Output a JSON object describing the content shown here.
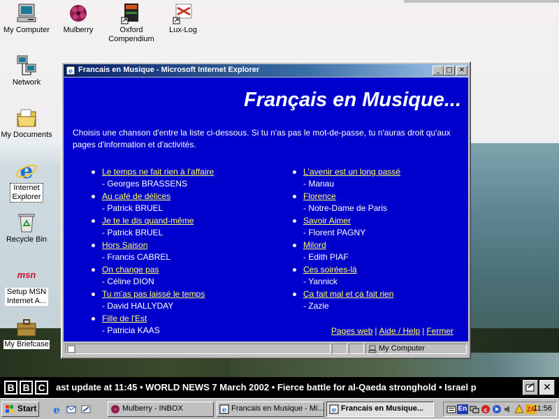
{
  "desktop": {
    "icons": [
      {
        "label": "My Computer",
        "icon": "my-computer-icon"
      },
      {
        "label": "Mulberry",
        "icon": "mulberry-icon"
      },
      {
        "label": "Oxford Compendium",
        "icon": "oxford-compendium-icon"
      },
      {
        "label": "Lux-Log",
        "icon": "lux-log-icon"
      },
      {
        "label": "Network",
        "icon": "network-icon"
      },
      {
        "label": "My Documents",
        "icon": "my-documents-icon"
      },
      {
        "label": "Internet Explorer",
        "icon": "internet-explorer-icon"
      },
      {
        "label": "Recycle Bin",
        "icon": "recycle-bin-icon"
      },
      {
        "label": "Setup MSN Internet A...",
        "icon": "msn-icon"
      },
      {
        "label": "My Briefcase",
        "icon": "briefcase-icon"
      }
    ]
  },
  "window": {
    "title": "Francais en Musique - Microsoft Internet Explorer",
    "heading": "Français en Musique...",
    "intro": "Choisis une chanson d'entre la liste ci-dessous. Si tu n'as pas le mot-de-passe, tu n'auras droit qu'aux pages d'information et d'activités.",
    "songs_left": [
      {
        "title": "Le temps ne fait rien à l'affaire",
        "artist": "- Georges BRASSENS"
      },
      {
        "title": "Au café de délices",
        "artist": "- Patrick BRUEL"
      },
      {
        "title": "Je te le dis quand-même",
        "artist": "- Patrick BRUEL"
      },
      {
        "title": "Hors Saison",
        "artist": "- Francis CABREL"
      },
      {
        "title": "On change pas",
        "artist": "- Céline DION"
      },
      {
        "title": "Tu m'as pas laissé le temps",
        "artist": "- David HALLYDAY"
      },
      {
        "title": "Fille de l'Est",
        "artist": "- Patricia KAAS"
      }
    ],
    "songs_right": [
      {
        "title": "L'avenir est un long passé",
        "artist": "- Manau"
      },
      {
        "title": "Florence",
        "artist": "- Notre-Dame de Paris"
      },
      {
        "title": "Savoir Aimer",
        "artist": "- Florent PAGNY"
      },
      {
        "title": "Milord",
        "artist": "- Edith PIAF"
      },
      {
        "title": "Ces soirées-là",
        "artist": "- Yannick"
      },
      {
        "title": "Ça fait mal et ça fait rien",
        "artist": "- Zazie"
      }
    ],
    "footer_links": {
      "pages_web": "Pages web",
      "aide": "Aide / Help",
      "fermer": "Fermer",
      "separator": "|"
    },
    "status_zone": "My Computer",
    "link_color": "#ffff66",
    "background_color": "#0000cc"
  },
  "ticker": {
    "logo_letters": [
      "B",
      "B",
      "C"
    ],
    "text": "ast update at 11:45  •  WORLD NEWS  7 March 2002  •  Fierce battle for al-Qaeda stronghold  •  Israel p",
    "close_label": "✕"
  },
  "taskbar": {
    "start_label": "Start",
    "tasks": [
      {
        "label": "Mulberry - INBOX",
        "active": false
      },
      {
        "label": "Francais en Musique - Mi...",
        "active": false
      },
      {
        "label": "Francais en Musique...",
        "active": true
      }
    ],
    "tray_lang": "En",
    "tray_za": "ZA",
    "clock": "11:56"
  }
}
